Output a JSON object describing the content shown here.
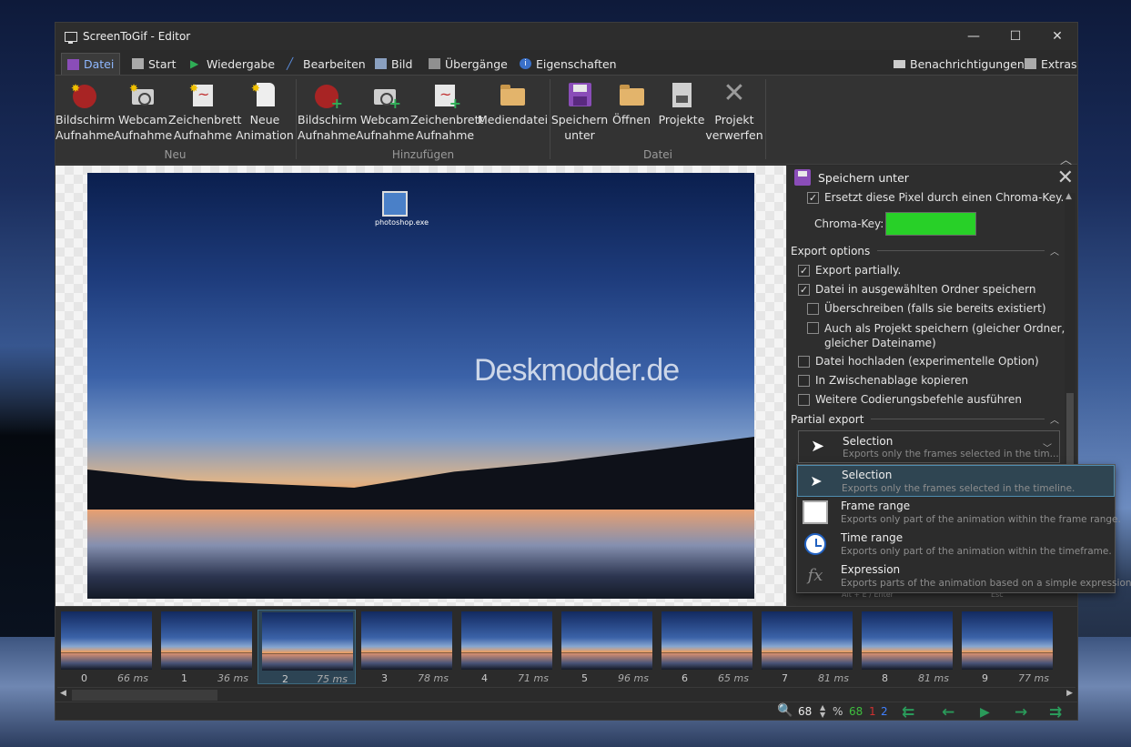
{
  "window": {
    "title": "ScreenToGif - Editor",
    "minimize": "—",
    "maximize": "☐",
    "close": "✕"
  },
  "tabs": [
    {
      "label": "Datei"
    },
    {
      "label": "Start"
    },
    {
      "label": "Wiedergabe"
    },
    {
      "label": "Bearbeiten"
    },
    {
      "label": "Bild"
    },
    {
      "label": "Übergänge"
    },
    {
      "label": "Eigenschaften"
    }
  ],
  "right_tabs": {
    "notifications": "Benachrichtigungen",
    "extras": "Extras"
  },
  "ribbon": {
    "new_group": "Neu",
    "add_group": "Hinzufügen",
    "file_group": "Datei",
    "new": [
      {
        "label": "Bildschirm\nAufnahme"
      },
      {
        "label": "Webcam\nAufnahme"
      },
      {
        "label": "Zeichenbrett\nAufnahme"
      },
      {
        "label": "Neue\nAnimation"
      }
    ],
    "add": [
      {
        "label": "Bildschirm\nAufnahme"
      },
      {
        "label": "Webcam\nAufnahme"
      },
      {
        "label": "Zeichenbrett\nAufnahme"
      },
      {
        "label": "Mediendatei"
      }
    ],
    "file": [
      {
        "label": "Speichern\nunter"
      },
      {
        "label": "Öffnen"
      },
      {
        "label": "Projekte"
      },
      {
        "label": "Projekt\nverwerfen"
      }
    ]
  },
  "canvas": {
    "watermark": "Deskmodder.de",
    "desktop_icon_label": "photoshop.exe"
  },
  "panel": {
    "title": "Speichern unter",
    "chroma_desc": "Ersetzt diese Pixel durch einen Chroma-Key.",
    "chroma_label": "Chroma-Key:",
    "chroma_color": "#28d028",
    "export_options": "Export options",
    "options": [
      {
        "label": "Export partially.",
        "checked": true
      },
      {
        "label": "Datei in ausgewählten Ordner speichern",
        "checked": true
      },
      {
        "label": "Überschreiben (falls sie bereits existiert)",
        "checked": false
      },
      {
        "label": "Auch als Projekt speichern (gleicher Ordner,",
        "label2": "gleicher Dateiname)",
        "checked": false
      },
      {
        "label": "Datei hochladen (experimentelle Option)",
        "checked": false
      },
      {
        "label": "In Zwischenablage kopieren",
        "checked": false
      },
      {
        "label": "Weitere Codierungsbefehle ausführen",
        "checked": false
      }
    ],
    "partial_export": "Partial export",
    "combo": {
      "title": "Selection",
      "desc": "Exports only the frames selected in the tim..."
    },
    "bottom_left": "Alt + E / Enter",
    "bottom_right": "Esc"
  },
  "dropdown": [
    {
      "title": "Selection",
      "desc": "Exports only the frames selected in the timeline."
    },
    {
      "title": "Frame range",
      "desc": "Exports only part of the animation within the frame range."
    },
    {
      "title": "Time range",
      "desc": "Exports only part of the animation within the timeframe."
    },
    {
      "title": "Expression",
      "desc": "Exports parts of the animation based on a simple expression."
    }
  ],
  "frames": [
    {
      "n": "0",
      "ms": "66 ms"
    },
    {
      "n": "1",
      "ms": "36 ms"
    },
    {
      "n": "2",
      "ms": "75 ms"
    },
    {
      "n": "3",
      "ms": "78 ms"
    },
    {
      "n": "4",
      "ms": "71 ms"
    },
    {
      "n": "5",
      "ms": "96 ms"
    },
    {
      "n": "6",
      "ms": "65 ms"
    },
    {
      "n": "7",
      "ms": "81 ms"
    },
    {
      "n": "8",
      "ms": "81 ms"
    },
    {
      "n": "9",
      "ms": "77 ms"
    }
  ],
  "status": {
    "zoom": "68",
    "zoom_unit": "%",
    "count_total": "68",
    "count_selected": "1",
    "count_third": "2"
  }
}
